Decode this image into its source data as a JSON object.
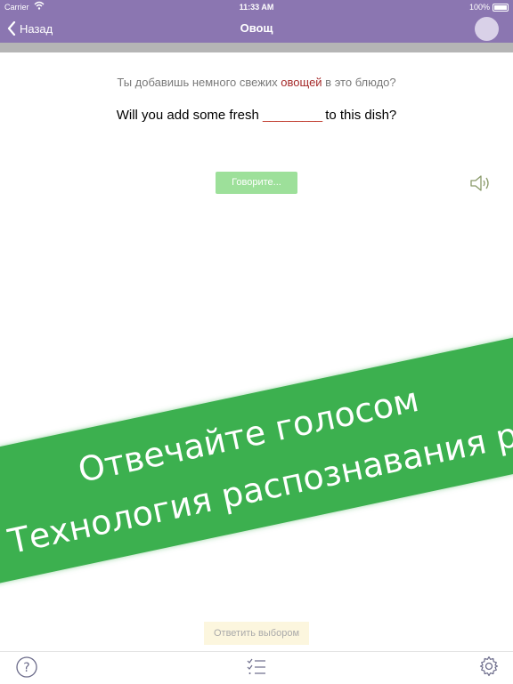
{
  "status_bar": {
    "carrier": "Carrier",
    "time": "11:33 AM",
    "battery": "100%"
  },
  "nav": {
    "back_label": "Назад",
    "title": "Овощ"
  },
  "exercise": {
    "ru_before": "Ты добавишь немного свежих ",
    "ru_highlight": "овощей",
    "ru_after": " в это  блюдо?",
    "en_before": "Will you add some fresh ",
    "en_blank": "_________",
    "en_after": " to this dish?",
    "speak_label": "Говорите..."
  },
  "banner": {
    "line1": "Отвечайте голосом",
    "line2": "Технология распознавания речи"
  },
  "answer_choice_label": "Ответить выбором",
  "icons": {
    "back": "chevron-left-icon",
    "speaker": "speaker-icon",
    "help": "question-icon",
    "list": "checklist-icon",
    "settings": "gear-icon"
  },
  "colors": {
    "nav_bar": "#8b76b1",
    "banner": "#3cb04f",
    "highlight": "#a52a2a",
    "speak_button": "#9de09a",
    "answer_button": "#fcf6de"
  }
}
